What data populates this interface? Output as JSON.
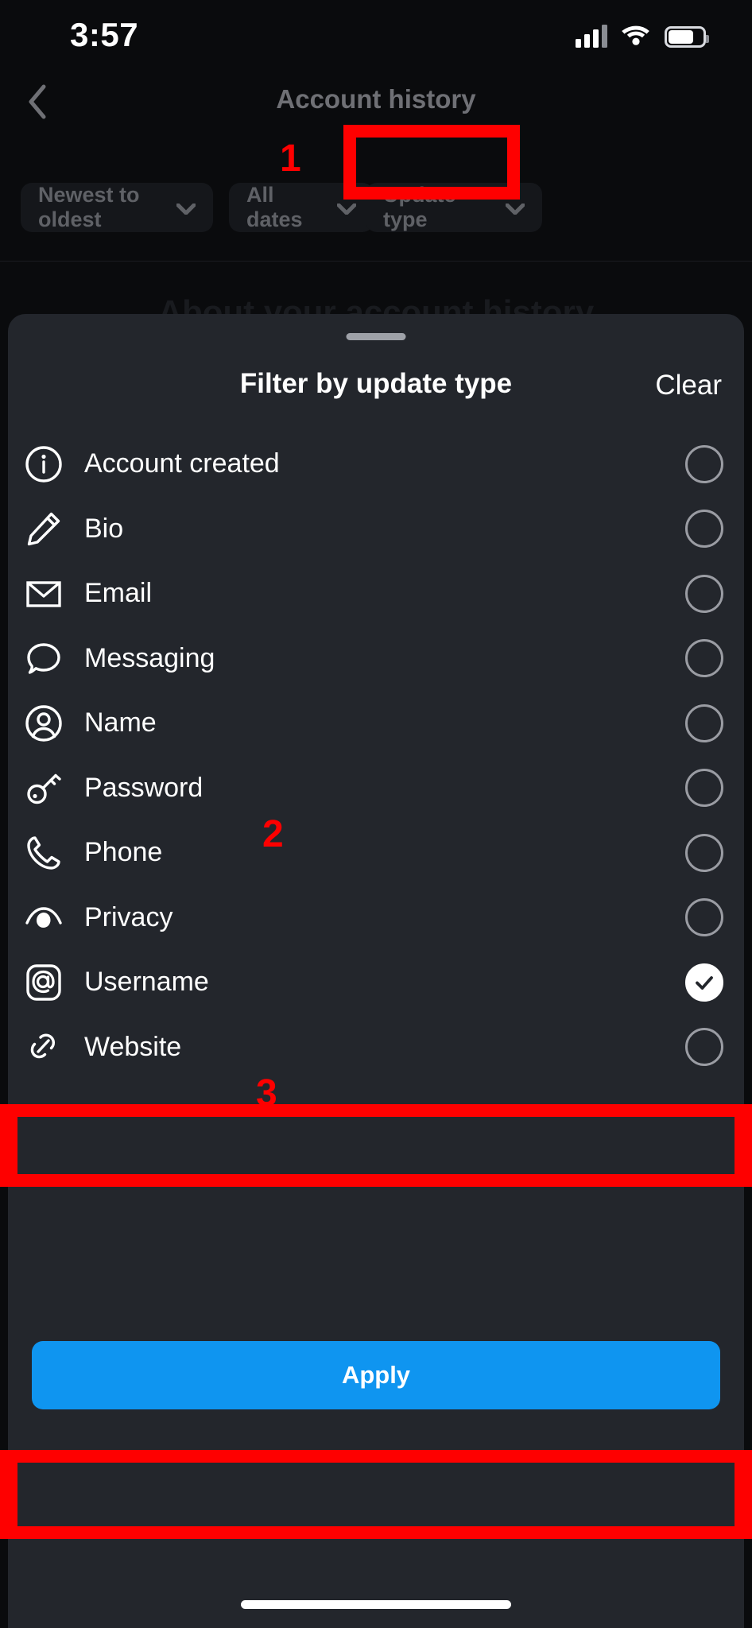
{
  "status_bar": {
    "time": "3:57",
    "signal_icon": "cellular-signal-icon",
    "wifi_icon": "wifi-icon",
    "battery_icon": "battery-icon"
  },
  "nav": {
    "back_icon": "back-chevron-icon",
    "title": "Account history"
  },
  "filters": {
    "sort_chip": "Newest to oldest",
    "dates_chip": "All dates",
    "type_chip": "Update type",
    "chevron_icon": "chevron-down-icon"
  },
  "page": {
    "obscured_heading": "About your account history"
  },
  "sheet": {
    "title": "Filter by update type",
    "clear_label": "Clear",
    "grabber": "sheet-grabber-handle",
    "options": [
      {
        "label": "Account created",
        "icon": "info-circle-icon",
        "selected": false
      },
      {
        "label": "Bio",
        "icon": "pencil-icon",
        "selected": false
      },
      {
        "label": "Email",
        "icon": "envelope-icon",
        "selected": false
      },
      {
        "label": "Messaging",
        "icon": "chat-bubble-icon",
        "selected": false
      },
      {
        "label": "Name",
        "icon": "person-circle-icon",
        "selected": false
      },
      {
        "label": "Password",
        "icon": "key-icon",
        "selected": false
      },
      {
        "label": "Phone",
        "icon": "phone-icon",
        "selected": false
      },
      {
        "label": "Privacy",
        "icon": "eye-privacy-icon",
        "selected": false
      },
      {
        "label": "Username",
        "icon": "at-sign-icon",
        "selected": true
      },
      {
        "label": "Website",
        "icon": "link-icon",
        "selected": false
      }
    ],
    "apply_label": "Apply"
  },
  "annotations": {
    "step1": "1",
    "step2": "2",
    "step3": "3",
    "highlight_color": "#fe0000"
  },
  "colors": {
    "accent_blue": "#0f95f0",
    "sheet_bg": "#23262c",
    "page_bg": "#0a0b0d",
    "chip_bg": "#15171b",
    "radio_outline": "#9a9ca3"
  }
}
